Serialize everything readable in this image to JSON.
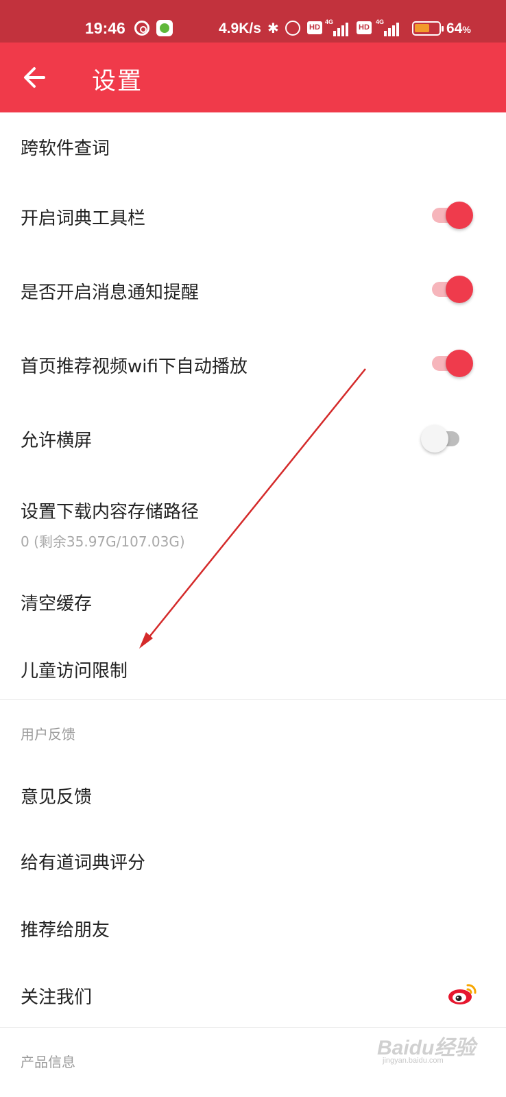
{
  "status_bar": {
    "time": "19:46",
    "net_speed": "4.9K/s",
    "hd": "HD",
    "net_type": "4G",
    "battery_level": "64",
    "battery_unit": "%",
    "battery_fill": 0.64,
    "colors": {
      "background": "#c2323d",
      "battery": "#f29a2c"
    }
  },
  "app_bar": {
    "title": "设置",
    "back_icon": "arrow-left-icon",
    "color": "#f03a4a"
  },
  "settings": {
    "cross_app_lookup": {
      "label": "跨软件查词"
    },
    "dict_toolbar": {
      "label": "开启词典工具栏",
      "enabled": true
    },
    "message_notify": {
      "label": "是否开启消息通知提醒",
      "enabled": true
    },
    "wifi_autoplay": {
      "label": "首页推荐视频wifi下自动播放",
      "enabled": true
    },
    "allow_landscape": {
      "label": "允许横屏",
      "enabled": false
    },
    "download_path": {
      "label": "设置下载内容存储路径",
      "value": "0 (剩余35.97G/107.03G)"
    },
    "clear_cache": {
      "label": "清空缓存"
    },
    "child_restriction": {
      "label": "儿童访问限制"
    }
  },
  "feedback_section": {
    "header": "用户反馈",
    "feedback": {
      "label": "意见反馈"
    },
    "rate_app": {
      "label": "给有道词典评分"
    },
    "recommend": {
      "label": "推荐给朋友"
    },
    "follow_us": {
      "label": "关注我们",
      "icon": "weibo-icon"
    }
  },
  "product_section": {
    "header": "产品信息"
  },
  "watermark": {
    "logo": "Baidu经验",
    "url": "jingyan.baidu.com"
  },
  "colors": {
    "accent": "#ef3b4c",
    "accent_light": "#f6b5bb",
    "annotation": "#d42a2a"
  }
}
